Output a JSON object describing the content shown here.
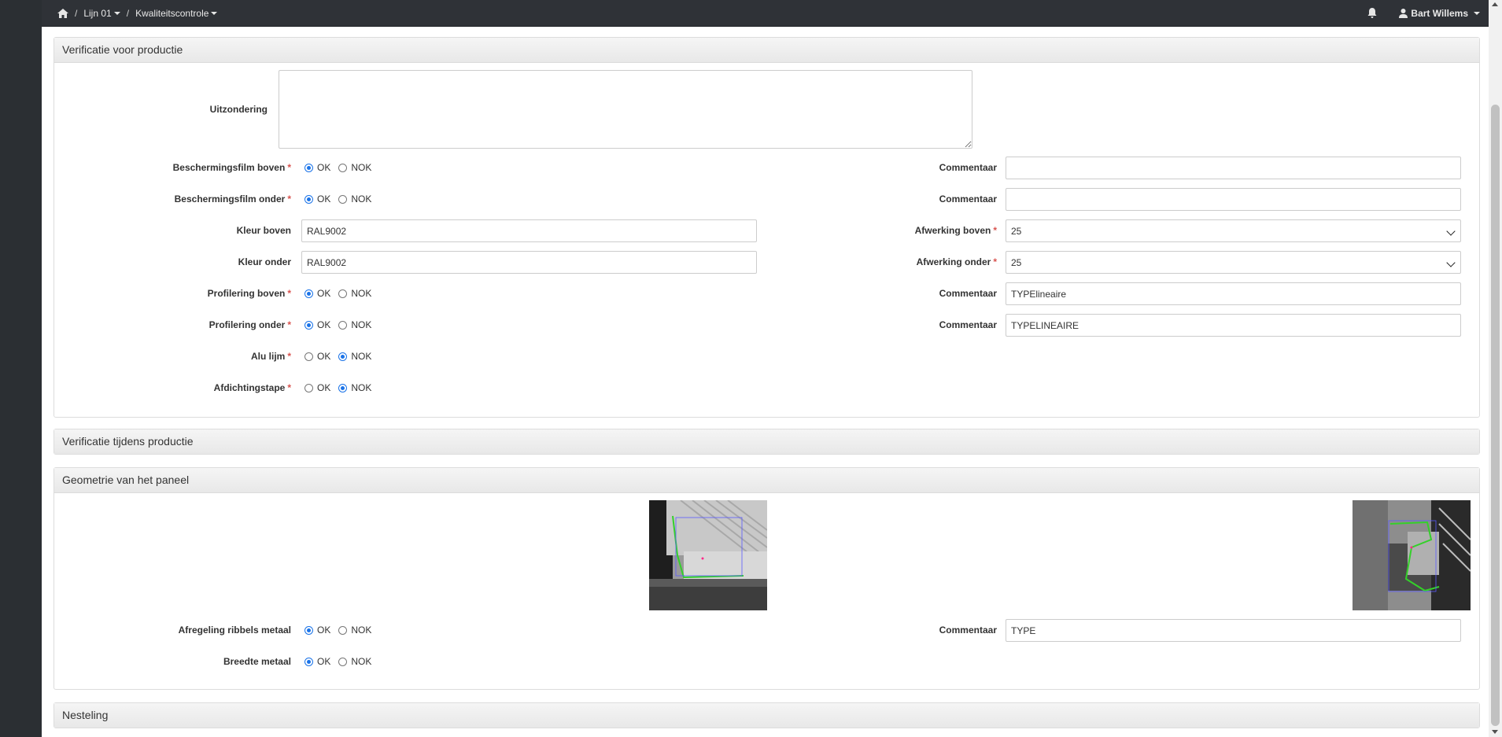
{
  "nav": {
    "breadcrumb": [
      {
        "label": "Lijn 01"
      },
      {
        "label": "Kwaliteitscontrole"
      }
    ],
    "user": "Bart Willems"
  },
  "panel1": {
    "title": "Verificatie voor productie",
    "exception_label": "Uitzondering",
    "exception_value": "",
    "rows": [
      {
        "label": "Beschermingsfilm boven",
        "required": true,
        "selected": "OK",
        "comment_label": "Commentaar",
        "comment": ""
      },
      {
        "label": "Beschermingsfilm onder",
        "required": true,
        "selected": "OK",
        "comment_label": "Commentaar",
        "comment": ""
      },
      {
        "label": "Profilering boven",
        "required": true,
        "selected": "OK",
        "comment_label": "Commentaar",
        "comment": "TYPElineaire"
      },
      {
        "label": "Profilering onder",
        "required": true,
        "selected": "OK",
        "comment_label": "Commentaar",
        "comment": "TYPELINEAIRE"
      },
      {
        "label": "Alu lijm",
        "required": true,
        "selected": "NOK"
      },
      {
        "label": "Afdichtingstape",
        "required": true,
        "selected": "NOK"
      }
    ],
    "kleur_boven": {
      "label": "Kleur boven",
      "value": "RAL9002"
    },
    "kleur_onder": {
      "label": "Kleur onder",
      "value": "RAL9002"
    },
    "afwerking_boven": {
      "label": "Afwerking boven",
      "value": "25"
    },
    "afwerking_onder": {
      "label": "Afwerking onder",
      "value": "25"
    },
    "ok": "OK",
    "nok": "NOK"
  },
  "panel2": {
    "title": "Verificatie tijdens productie"
  },
  "panel3": {
    "title": "Geometrie van het paneel",
    "rows": [
      {
        "label": "Afregeling ribbels metaal",
        "selected": "OK",
        "comment_label": "Commentaar",
        "comment": "TYPE"
      },
      {
        "label": "Breedte metaal",
        "selected": "OK"
      }
    ]
  },
  "panel4": {
    "title": "Nesteling"
  },
  "colors": {
    "accent": "#1a73e8",
    "required": "#d9534f",
    "navbar": "#2f3237"
  },
  "icons": [
    "home-icon",
    "bell-icon",
    "user-icon",
    "chevron-down-icon"
  ]
}
